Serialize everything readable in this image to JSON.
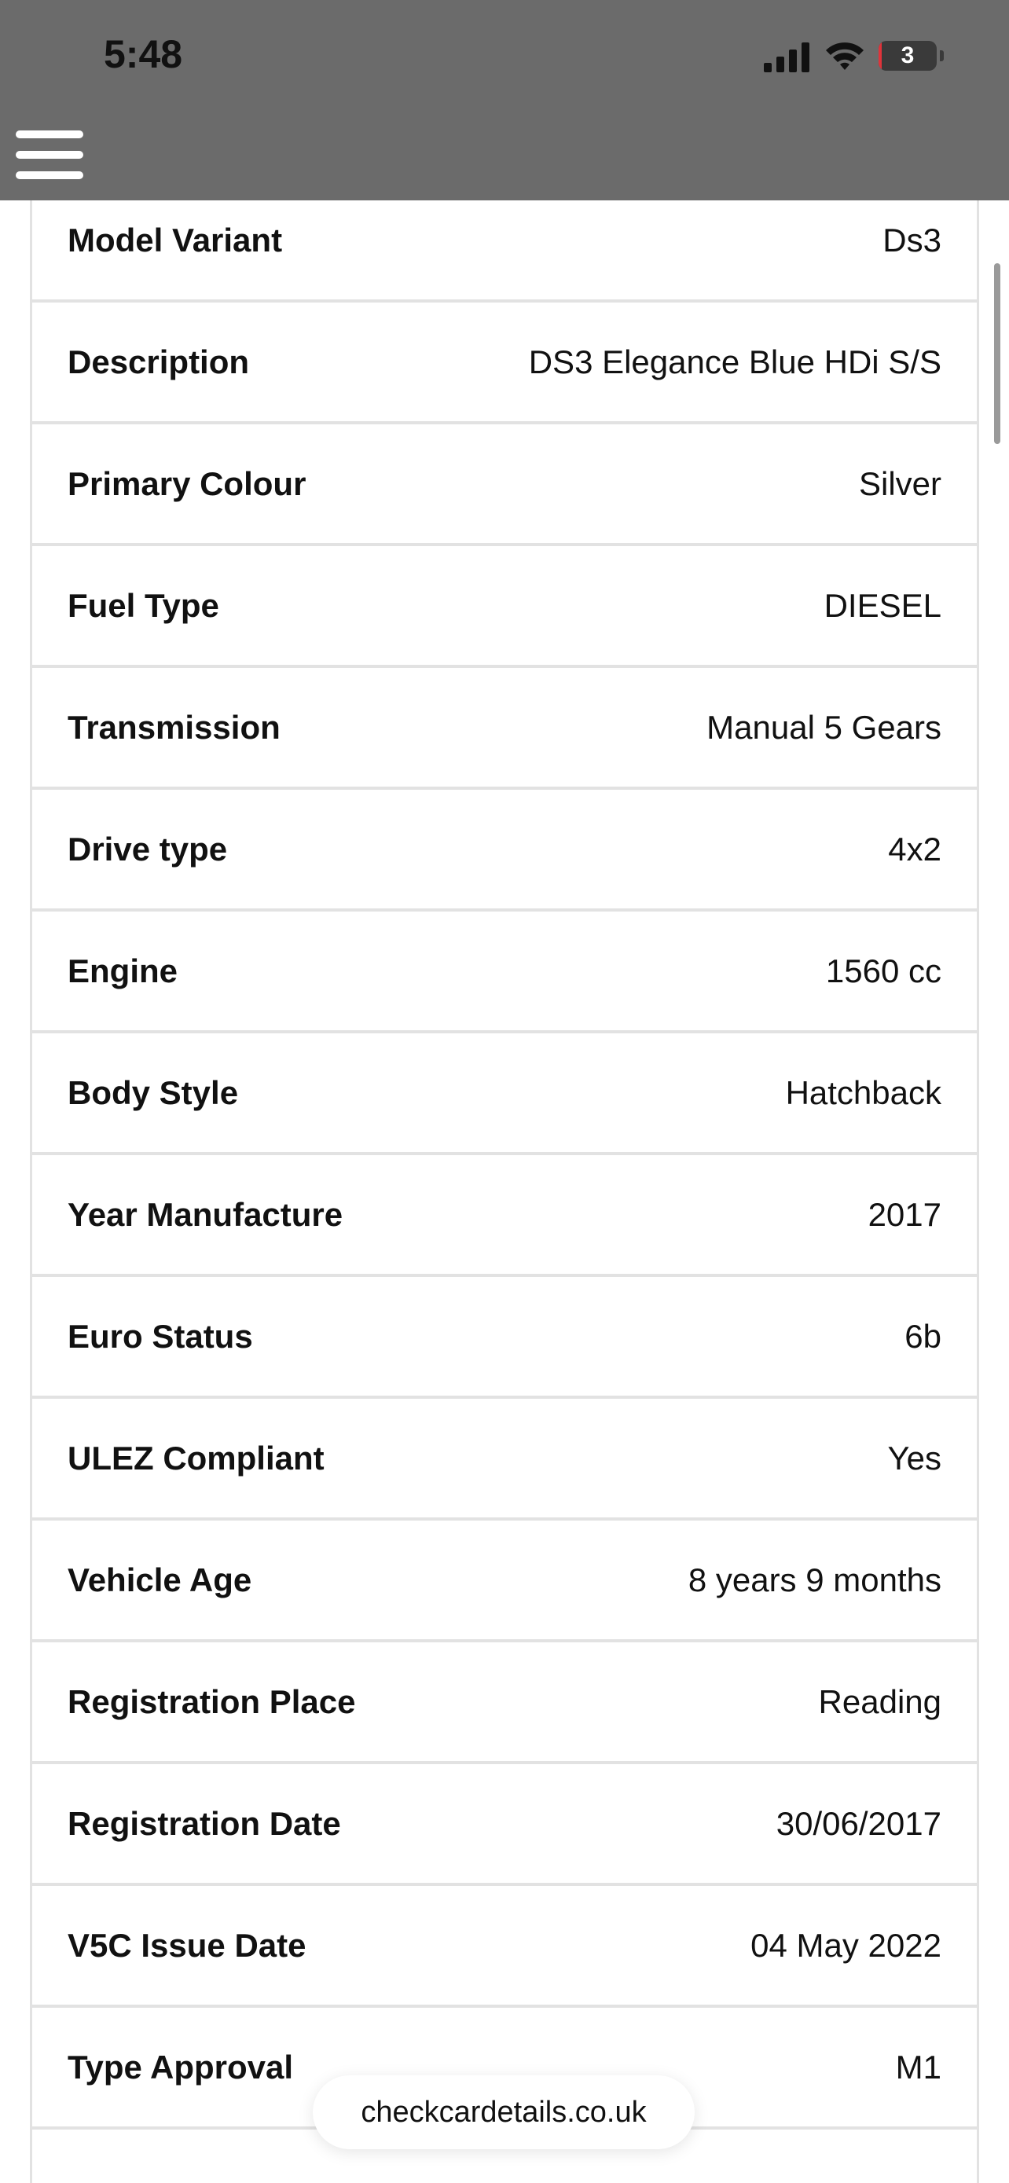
{
  "status_bar": {
    "time": "5:48",
    "battery_level": "3",
    "signal_icon": "cellular-signal-icon",
    "wifi_icon": "wifi-icon",
    "battery_icon": "battery-icon"
  },
  "nav": {
    "menu_icon": "hamburger-menu-icon"
  },
  "details": [
    {
      "label": "Model Variant",
      "value": "Ds3"
    },
    {
      "label": "Description",
      "value": "DS3 Elegance Blue HDi S/S"
    },
    {
      "label": "Primary Colour",
      "value": "Silver"
    },
    {
      "label": "Fuel Type",
      "value": "DIESEL"
    },
    {
      "label": "Transmission",
      "value": "Manual 5 Gears"
    },
    {
      "label": "Drive type",
      "value": "4x2"
    },
    {
      "label": "Engine",
      "value": "1560 cc"
    },
    {
      "label": "Body Style",
      "value": "Hatchback"
    },
    {
      "label": "Year Manufacture",
      "value": "2017"
    },
    {
      "label": "Euro Status",
      "value": "6b"
    },
    {
      "label": "ULEZ Compliant",
      "value": "Yes"
    },
    {
      "label": "Vehicle Age",
      "value": "8 years 9 months"
    },
    {
      "label": "Registration Place",
      "value": "Reading"
    },
    {
      "label": "Registration Date",
      "value": "30/06/2017"
    },
    {
      "label": "V5C Issue Date",
      "value": "04 May 2022"
    },
    {
      "label": "Type Approval",
      "value": "M1"
    }
  ],
  "browser": {
    "url": "checkcardetails.co.uk"
  },
  "colors": {
    "topbar": "#6b6b6b",
    "divider": "#e2e2e2",
    "battery_low": "#e0333a"
  }
}
